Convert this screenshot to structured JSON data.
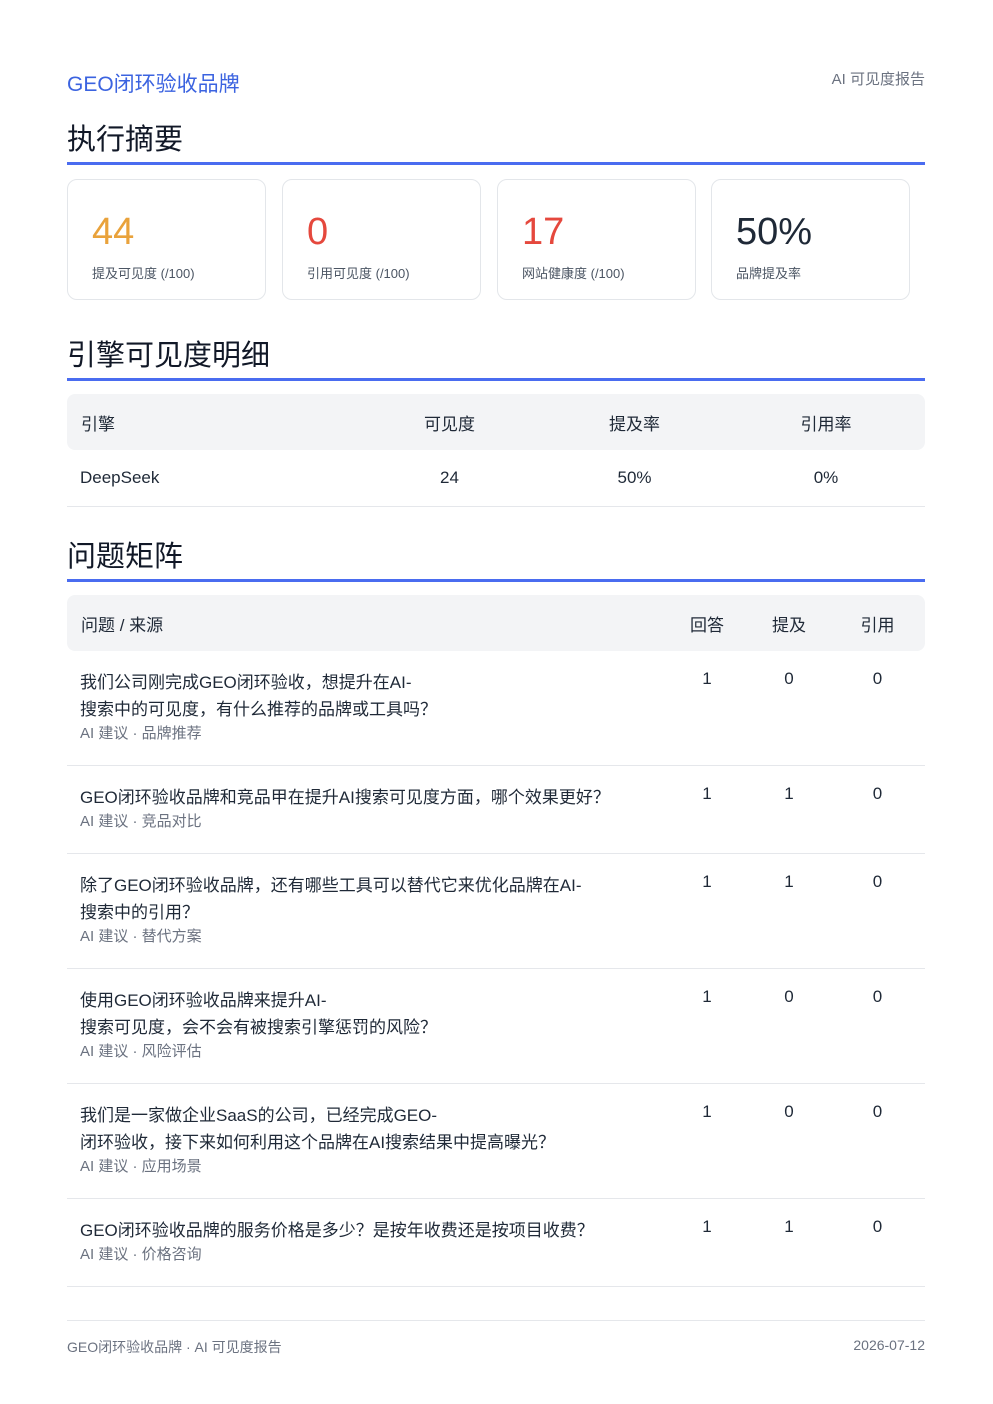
{
  "header": {
    "brand": "GEO闭环验收品牌",
    "report_label": "AI 可见度报告"
  },
  "sections": {
    "executive_summary": "执行摘要",
    "engine_detail": "引擎可见度明细",
    "question_matrix": "问题矩阵"
  },
  "kpis": [
    {
      "value": "44",
      "label": "提及可见度 (/100)",
      "color": "#e9a23b"
    },
    {
      "value": "0",
      "label": "引用可见度 (/100)",
      "color": "#e5483d"
    },
    {
      "value": "17",
      "label": "网站健康度 (/100)",
      "color": "#e5483d"
    },
    {
      "value": "50%",
      "label": "品牌提及率",
      "color": "#1f2937"
    }
  ],
  "engine_table": {
    "headers": [
      "引擎",
      "可见度",
      "提及率",
      "引用率"
    ],
    "rows": [
      {
        "engine": "DeepSeek",
        "visibility": "24",
        "mention_rate": "50%",
        "citation_rate": "0%"
      }
    ]
  },
  "question_table": {
    "headers": [
      "问题 / 来源",
      "回答",
      "提及",
      "引用"
    ],
    "rows": [
      {
        "line1": "我们公司刚完成GEO闭环验收，想提升在AI-",
        "line2": "搜索中的可见度，有什么推荐的品牌或工具吗？",
        "source": "AI 建议 · 品牌推荐",
        "answers": "1",
        "mentions": "0",
        "citations": "0"
      },
      {
        "line1": "GEO闭环验收品牌和竞品甲在提升AI搜索可见度方面，哪个效果更好？",
        "line2": "",
        "source": "AI 建议 · 竞品对比",
        "answers": "1",
        "mentions": "1",
        "citations": "0"
      },
      {
        "line1": "除了GEO闭环验收品牌，还有哪些工具可以替代它来优化品牌在AI-",
        "line2": "搜索中的引用？",
        "source": "AI 建议 · 替代方案",
        "answers": "1",
        "mentions": "1",
        "citations": "0"
      },
      {
        "line1": "使用GEO闭环验收品牌来提升AI-",
        "line2": "搜索可见度，会不会有被搜索引擎惩罚的风险？",
        "source": "AI 建议 · 风险评估",
        "answers": "1",
        "mentions": "0",
        "citations": "0"
      },
      {
        "line1": "我们是一家做企业SaaS的公司，已经完成GEO-",
        "line2": "闭环验收，接下来如何利用这个品牌在AI搜索结果中提高曝光？",
        "source": "AI 建议 · 应用场景",
        "answers": "1",
        "mentions": "0",
        "citations": "0"
      },
      {
        "line1": "GEO闭环验收品牌的服务价格是多少？是按年收费还是按项目收费？",
        "line2": "",
        "source": "AI 建议 · 价格咨询",
        "answers": "1",
        "mentions": "1",
        "citations": "0"
      }
    ]
  },
  "footer": {
    "left": "GEO闭环验收品牌 · AI 可见度报告",
    "date": "2026-07-12"
  }
}
